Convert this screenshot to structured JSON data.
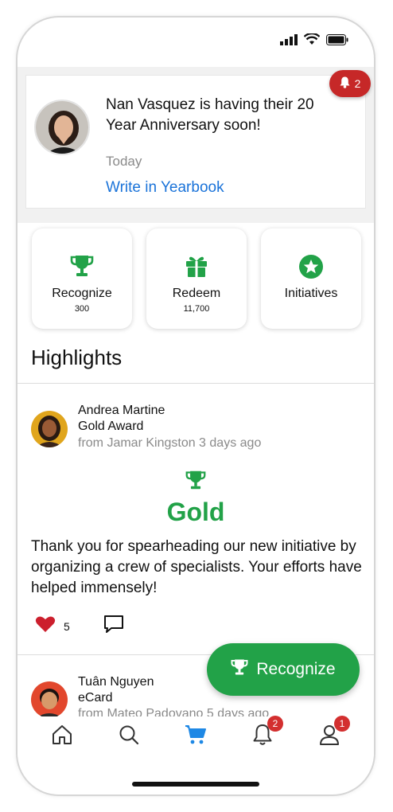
{
  "status_bar": {
    "icons": [
      "signal-icon",
      "wifi-icon",
      "battery-icon"
    ]
  },
  "announcement": {
    "text": "Nan Vasquez is having their 20 Year Anniversary soon!",
    "time": "Today",
    "link_label": "Write in Yearbook",
    "notification_count": "2"
  },
  "actions": [
    {
      "label": "Recognize",
      "sub": "300",
      "icon": "trophy-icon"
    },
    {
      "label": "Redeem",
      "sub": "11,700",
      "icon": "gift-icon"
    },
    {
      "label": "Initiatives",
      "sub": "",
      "icon": "star-badge-icon"
    }
  ],
  "highlights": {
    "title": "Highlights",
    "posts": [
      {
        "name": "Andrea Martine",
        "award": "Gold Award",
        "from": "from Jamar Kingston 3 days ago",
        "award_title": "Gold",
        "message": "Thank you for spearheading our new initiative by organizing a crew of specialists. Your efforts have helped immensely!",
        "likes": "5"
      },
      {
        "name": "Tuân Nguyen",
        "award": "eCard",
        "from": "from Mateo Padovano 5 days ago"
      }
    ]
  },
  "fab": {
    "label": "Recognize"
  },
  "nav": {
    "items": [
      "home-icon",
      "search-icon",
      "cart-icon",
      "bell-icon",
      "profile-icon"
    ],
    "bell_badge": "2",
    "profile_badge": "1"
  },
  "colors": {
    "accent_green": "#22a248",
    "link_blue": "#1a73d9",
    "alert_red": "#c62828",
    "cart_blue": "#1e88e5"
  }
}
